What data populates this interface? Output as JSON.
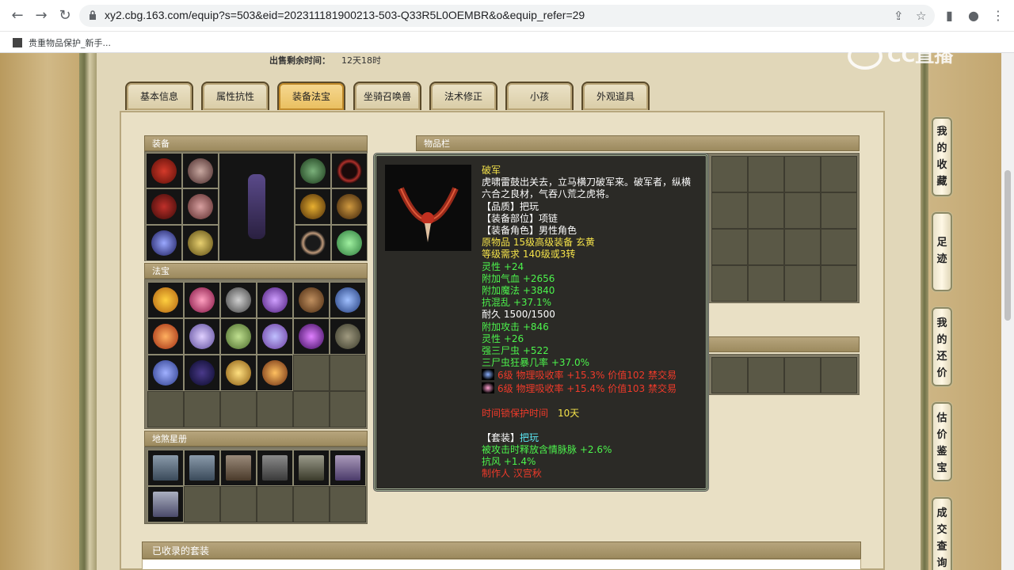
{
  "browser": {
    "url": "xy2.cbg.163.com/equip?s=503&eid=202311181900213-503-Q33R5L0OEMBR&o&equip_refer=29",
    "bookmark": "贵重物品保护_新手..."
  },
  "sale": {
    "label": "出售剩余时间：",
    "value": "12天18时"
  },
  "tabs": [
    "基本信息",
    "属性抗性",
    "装备法宝",
    "坐骑召唤兽",
    "法术修正",
    "小孩",
    "外观道具"
  ],
  "active_tab": "装备法宝",
  "sections": {
    "equipment": "装备",
    "fabao": "法宝",
    "dishasheng": "地煞星册",
    "inventory": "物品栏",
    "collected_sets": "已收录的套装"
  },
  "tooltip": {
    "name": "破军",
    "desc1": "虎啸雷鼓出关去，立马横刀破军来。破军者，纵横",
    "desc2": "六合之良材，气吞八荒之虎将。",
    "quality": "【品质】把玩",
    "slot": "【装备部位】项链",
    "role": "【装备角色】男性角色",
    "origin": "原物品 15级高级装备 玄黄",
    "level_req": "等级需求 140级或3转",
    "lingxing1": "灵性 +24",
    "hp": "附加气血 +2656",
    "mp": "附加魔法 +3840",
    "resist": "抗混乱 +37.1%",
    "durability": "耐久 1500/1500",
    "attack": "附加攻击 +846",
    "lingxing2": "灵性 +26",
    "worm": "强三尸虫 +522",
    "worm_crit": "三尸虫狂暴几率 +37.0%",
    "gem1": "6级 物理吸收率 +15.3% 价值102 禁交易",
    "gem2": "6级 物理吸收率 +15.4% 价值103 禁交易",
    "protect_label": "时间锁保护时间",
    "protect_value": "10天",
    "set_label": "【套装】",
    "set_value": "把玩",
    "set_effect": "被攻击时释放含情脉脉 +2.6%",
    "wind": "抗风 +1.4%",
    "maker": "制作人 汉宫秋"
  },
  "side_nav": [
    "我的收藏",
    "足迹",
    "我的还价",
    "估价鉴宝",
    "成交查询"
  ],
  "watermark": "CC直播",
  "colors": {
    "tooltip_bg": "#2b2a26",
    "name": "#f5e34a",
    "green": "#4cf34c",
    "red": "#f03a2a",
    "active_tab": "#e9be5e"
  }
}
